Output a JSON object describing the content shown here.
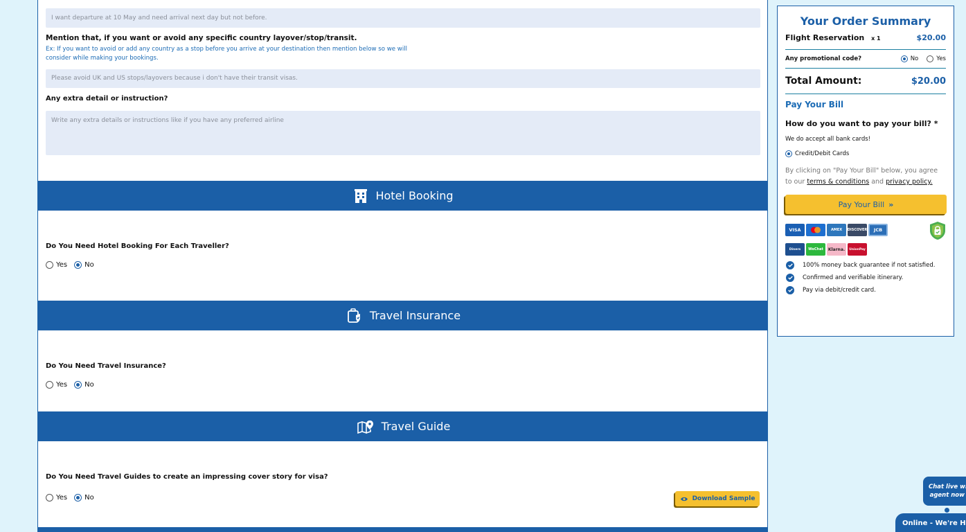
{
  "form": {
    "arrival_input": {
      "placeholder": "I want departure at 10 May and need arrival next day but not before."
    },
    "layover": {
      "label": "Mention that, if you want or avoid any specific country layover/stop/transit.",
      "hint": "Ex: If you want to avoid or add any country as a stop before you arrive at your destination then mention below so we will consider while making your bookings.",
      "placeholder": "Please avoid UK and US stops/layovers because i don't have their transit visas."
    },
    "extra": {
      "label": "Any extra detail or instruction?",
      "placeholder": "Write any extra details or instructions like if you have any preferred airline"
    }
  },
  "hotel": {
    "title": "Hotel Booking",
    "icon": "building-icon",
    "question": "Do You Need Hotel Booking For Each Traveller?",
    "yes": "Yes",
    "no": "No",
    "selected": "No"
  },
  "insurance": {
    "title": "Travel Insurance",
    "icon": "luggage-shield-icon",
    "question": "Do You Need Travel Insurance?",
    "yes": "Yes",
    "no": "No",
    "selected": "No"
  },
  "guide": {
    "title": "Travel Guide",
    "icon": "map-pin-icon",
    "question": "Do You Need Travel Guides to create an impressing cover story for visa?",
    "yes": "Yes",
    "no": "No",
    "selected": "No",
    "download_label": "Download Sample"
  },
  "summary": {
    "title": "Your Order Summary",
    "item_name": "Flight Reservation",
    "item_qty": "x 1",
    "item_price": "$20.00",
    "promo_label": "Any promotional code?",
    "promo_no": "No",
    "promo_yes": "Yes",
    "promo_selected": "No",
    "total_label": "Total Amount:",
    "total_value": "$20.00",
    "pay_heading": "Pay Your Bill",
    "pay_question": "How do you want to pay your bill?",
    "required_mark": "*",
    "accept_note": "We do accept all bank cards!",
    "method": "Credit/Debit Cards",
    "agree_prefix": "By clicking on \"Pay Your Bill\" below, you agree to our",
    "terms_link": "terms & conditions",
    "and_text": "and",
    "privacy_link": "privacy policy.",
    "pay_button": "Pay Your Bill",
    "pay_button_icon": "»",
    "cards_row1": [
      "VISA",
      "MC",
      "AMEX",
      "DISCOVER",
      "JCB"
    ],
    "cards_row2": [
      "Diners",
      "WeChat",
      "Klarna.",
      "UnionPay"
    ],
    "benefits": [
      "100% money back guarantee if not satisfied.",
      "Confirmed and verifiable itinerary.",
      "Pay via debit/credit card."
    ]
  },
  "chat": {
    "bubble_line1": "Chat live with",
    "bubble_line2": "agent now",
    "tab_label": "Online - We're Here"
  },
  "colors": {
    "primary": "#1b5fa7",
    "accent": "#f5c02f",
    "input_bg": "#e4ebf7",
    "page_bg": "#dff3fb"
  }
}
